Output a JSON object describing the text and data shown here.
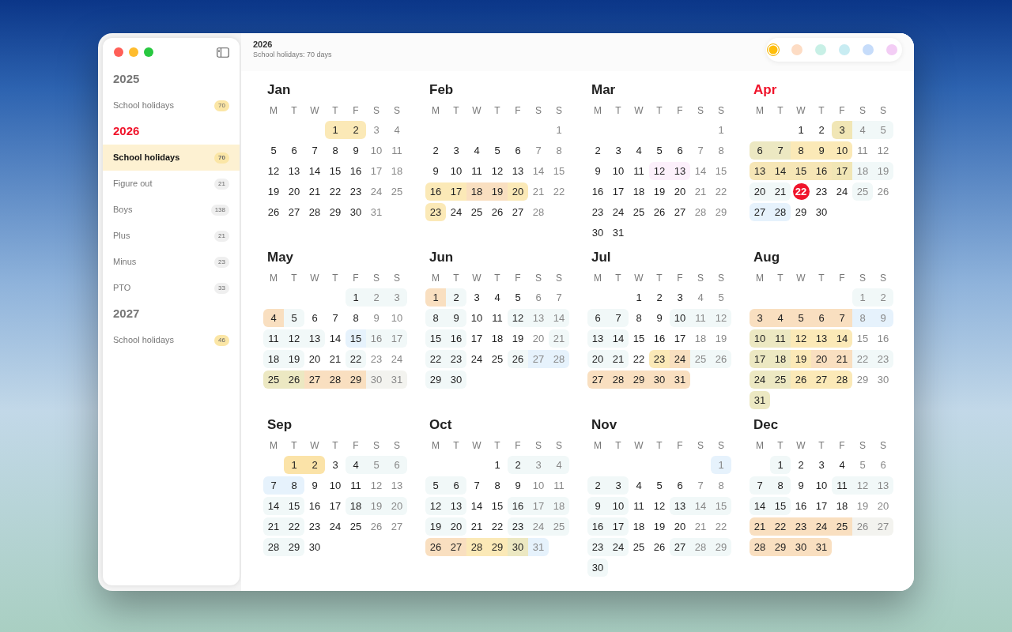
{
  "sidebar": {
    "years": [
      {
        "year": "2025",
        "current": false,
        "items": [
          {
            "label": "School holidays",
            "count": "70",
            "color": "#fbe6a6",
            "selected": false
          }
        ]
      },
      {
        "year": "2026",
        "current": true,
        "items": [
          {
            "label": "School holidays",
            "count": "70",
            "color": "#fbe6a6",
            "selected": true
          },
          {
            "label": "Figure out",
            "count": "21",
            "color": "#efefef",
            "selected": false
          },
          {
            "label": "Boys",
            "count": "138",
            "color": "#efefef",
            "selected": false
          },
          {
            "label": "Plus",
            "count": "21",
            "color": "#efefef",
            "selected": false
          },
          {
            "label": "Minus",
            "count": "23",
            "color": "#efefef",
            "selected": false
          },
          {
            "label": "PTO",
            "count": "33",
            "color": "#efefef",
            "selected": false
          }
        ]
      },
      {
        "year": "2027",
        "current": false,
        "items": [
          {
            "label": "School holidays",
            "count": "46",
            "color": "#fbe6a6",
            "selected": false
          }
        ]
      }
    ]
  },
  "header": {
    "title": "2026",
    "subtitle": "School holidays: 70 days"
  },
  "palette": [
    {
      "color": "#ffbe0b",
      "selected": true
    },
    {
      "color": "#fddcc4",
      "selected": false
    },
    {
      "color": "#c8f0e6",
      "selected": false
    },
    {
      "color": "#c8ecf2",
      "selected": false
    },
    {
      "color": "#c6dcfa",
      "selected": false
    },
    {
      "color": "#f3cdf5",
      "selected": false
    }
  ],
  "months": [
    {
      "name": "Jan",
      "current": false,
      "weekdays": [
        "M",
        "T",
        "W",
        "T",
        "F",
        "S",
        "S"
      ],
      "weeks": [
        [
          {
            "day": "1",
            "color": "#fbe9b7"
          },
          {
            "day": "2",
            "color": "#fbe9b7"
          },
          {
            "day": "3"
          },
          {
            "day": "4"
          }
        ],
        [
          {
            "day": "5"
          },
          {
            "day": "6"
          },
          {
            "day": "7"
          },
          {
            "day": "8"
          },
          {
            "day": "9"
          },
          {
            "day": "10"
          },
          {
            "day": "11"
          }
        ],
        [
          {
            "day": "12"
          },
          {
            "day": "13"
          },
          {
            "day": "14"
          },
          {
            "day": "15"
          },
          {
            "day": "16"
          },
          {
            "day": "17"
          },
          {
            "day": "18"
          }
        ],
        [
          {
            "day": "19"
          },
          {
            "day": "20"
          },
          {
            "day": "21"
          },
          {
            "day": "22"
          },
          {
            "day": "23"
          },
          {
            "day": "24"
          },
          {
            "day": "25"
          }
        ],
        [
          {
            "day": "26"
          },
          {
            "day": "27"
          },
          {
            "day": "28"
          },
          {
            "day": "29"
          },
          {
            "day": "30"
          },
          {
            "day": "31"
          }
        ]
      ]
    },
    {
      "name": "Feb",
      "current": false,
      "weekdays": [
        "M",
        "T",
        "W",
        "T",
        "F",
        "S",
        "S"
      ],
      "weeks": [
        [
          {
            "day": "1"
          }
        ],
        [
          {
            "day": "2"
          },
          {
            "day": "3"
          },
          {
            "day": "4"
          },
          {
            "day": "5"
          },
          {
            "day": "6"
          },
          {
            "day": "7"
          },
          {
            "day": "8"
          }
        ],
        [
          {
            "day": "9"
          },
          {
            "day": "10"
          },
          {
            "day": "11"
          },
          {
            "day": "12"
          },
          {
            "day": "13"
          },
          {
            "day": "14"
          },
          {
            "day": "15"
          }
        ],
        [
          {
            "day": "16",
            "color": "#fbe9b7"
          },
          {
            "day": "17",
            "color": "#fbe9b7"
          },
          {
            "day": "18",
            "color": "#f9dfc0"
          },
          {
            "day": "19",
            "color": "#f9dfc0"
          },
          {
            "day": "20",
            "color": "#fbe9b7"
          },
          {
            "day": "21"
          },
          {
            "day": "22"
          }
        ],
        [
          {
            "day": "23",
            "color": "#fbe9b7"
          },
          {
            "day": "24"
          },
          {
            "day": "25"
          },
          {
            "day": "26"
          },
          {
            "day": "27"
          },
          {
            "day": "28"
          }
        ]
      ]
    },
    {
      "name": "Mar",
      "current": false,
      "weekdays": [
        "M",
        "T",
        "W",
        "T",
        "F",
        "S",
        "S"
      ],
      "weeks": [
        [
          {
            "day": "1"
          }
        ],
        [
          {
            "day": "2"
          },
          {
            "day": "3"
          },
          {
            "day": "4"
          },
          {
            "day": "5"
          },
          {
            "day": "6"
          },
          {
            "day": "7"
          },
          {
            "day": "8"
          }
        ],
        [
          {
            "day": "9"
          },
          {
            "day": "10"
          },
          {
            "day": "11"
          },
          {
            "day": "12",
            "color": "#fcf0fb"
          },
          {
            "day": "13",
            "color": "#fcf0fb"
          },
          {
            "day": "14"
          },
          {
            "day": "15"
          }
        ],
        [
          {
            "day": "16"
          },
          {
            "day": "17"
          },
          {
            "day": "18"
          },
          {
            "day": "19"
          },
          {
            "day": "20"
          },
          {
            "day": "21"
          },
          {
            "day": "22"
          }
        ],
        [
          {
            "day": "23"
          },
          {
            "day": "24"
          },
          {
            "day": "25"
          },
          {
            "day": "26"
          },
          {
            "day": "27"
          },
          {
            "day": "28"
          },
          {
            "day": "29"
          }
        ],
        [
          {
            "day": "30"
          },
          {
            "day": "31"
          }
        ]
      ]
    },
    {
      "name": "Apr",
      "current": true,
      "weekdays": [
        "M",
        "T",
        "W",
        "T",
        "F",
        "S",
        "S"
      ],
      "weeks": [
        [
          {
            "day": "1"
          },
          {
            "day": "2"
          },
          {
            "day": "3",
            "color": "#f1e6b5"
          },
          {
            "day": "4",
            "color": "#f1f8f8"
          },
          {
            "day": "5",
            "color": "#f1f8f8"
          }
        ],
        [
          {
            "day": "6",
            "color": "#ece8c2"
          },
          {
            "day": "7",
            "color": "#ece8c2"
          },
          {
            "day": "8",
            "color": "#fbe9b7"
          },
          {
            "day": "9",
            "color": "#fbe9b7"
          },
          {
            "day": "10",
            "color": "#fbe9b7"
          },
          {
            "day": "11"
          },
          {
            "day": "12"
          }
        ],
        [
          {
            "day": "13",
            "color": "#f6e6b6"
          },
          {
            "day": "14",
            "color": "#f6e6b6"
          },
          {
            "day": "15",
            "color": "#f6e6b6"
          },
          {
            "day": "16",
            "color": "#f6e6b6"
          },
          {
            "day": "17",
            "color": "#f1e6b5"
          },
          {
            "day": "18",
            "color": "#f1f8f8"
          },
          {
            "day": "19",
            "color": "#f1f8f8"
          }
        ],
        [
          {
            "day": "20",
            "color": "#f1f8f8"
          },
          {
            "day": "21",
            "color": "#f1f8f8"
          },
          {
            "day": "22",
            "today": true
          },
          {
            "day": "23"
          },
          {
            "day": "24"
          },
          {
            "day": "25",
            "color": "#f1f8f8"
          },
          {
            "day": "26"
          }
        ],
        [
          {
            "day": "27",
            "color": "#e6f2fc"
          },
          {
            "day": "28",
            "color": "#e6f2fc"
          },
          {
            "day": "29"
          },
          {
            "day": "30"
          }
        ]
      ]
    },
    {
      "name": "May",
      "current": false,
      "weekdays": [
        "M",
        "T",
        "W",
        "T",
        "F",
        "S",
        "S"
      ],
      "weeks": [
        [
          {
            "day": "1",
            "color": "#f1f8f8"
          },
          {
            "day": "2",
            "color": "#f1f8f8"
          },
          {
            "day": "3",
            "color": "#f1f8f8"
          }
        ],
        [
          {
            "day": "4",
            "color": "#f9dfc0"
          },
          {
            "day": "5",
            "color": "#f1f8f8"
          },
          {
            "day": "6"
          },
          {
            "day": "7"
          },
          {
            "day": "8"
          },
          {
            "day": "9"
          },
          {
            "day": "10"
          }
        ],
        [
          {
            "day": "11",
            "color": "#f1f8f8"
          },
          {
            "day": "12",
            "color": "#f1f8f8"
          },
          {
            "day": "13",
            "color": "#f1f8f8"
          },
          {
            "day": "14"
          },
          {
            "day": "15",
            "color": "#e6f2fc"
          },
          {
            "day": "16",
            "color": "#f1f8f8"
          },
          {
            "day": "17",
            "color": "#f1f8f8"
          }
        ],
        [
          {
            "day": "18",
            "color": "#f1f8f8"
          },
          {
            "day": "19",
            "color": "#f1f8f8"
          },
          {
            "day": "20"
          },
          {
            "day": "21"
          },
          {
            "day": "22",
            "color": "#f1f8f8"
          },
          {
            "day": "23"
          },
          {
            "day": "24"
          }
        ],
        [
          {
            "day": "25",
            "color": "#ece8c2"
          },
          {
            "day": "26",
            "color": "#ece8c2"
          },
          {
            "day": "27",
            "color": "#f9dfc0"
          },
          {
            "day": "28",
            "color": "#f9dfc0"
          },
          {
            "day": "29",
            "color": "#f9dfc0"
          },
          {
            "day": "30",
            "color": "#f3f3ef"
          },
          {
            "day": "31",
            "color": "#f3f3ef"
          }
        ]
      ]
    },
    {
      "name": "Jun",
      "current": false,
      "weekdays": [
        "M",
        "T",
        "W",
        "T",
        "F",
        "S",
        "S"
      ],
      "weeks": [
        [
          {
            "day": "1",
            "color": "#f9dfc0"
          },
          {
            "day": "2",
            "color": "#f1f8f8"
          },
          {
            "day": "3"
          },
          {
            "day": "4"
          },
          {
            "day": "5"
          },
          {
            "day": "6"
          },
          {
            "day": "7"
          }
        ],
        [
          {
            "day": "8",
            "color": "#f1f8f8"
          },
          {
            "day": "9",
            "color": "#f1f8f8"
          },
          {
            "day": "10"
          },
          {
            "day": "11"
          },
          {
            "day": "12",
            "color": "#f1f8f8"
          },
          {
            "day": "13",
            "color": "#f1f8f8"
          },
          {
            "day": "14",
            "color": "#f1f8f8"
          }
        ],
        [
          {
            "day": "15",
            "color": "#f1f8f8"
          },
          {
            "day": "16",
            "color": "#f1f8f8"
          },
          {
            "day": "17"
          },
          {
            "day": "18"
          },
          {
            "day": "19"
          },
          {
            "day": "20"
          },
          {
            "day": "21",
            "color": "#f1f8f8"
          }
        ],
        [
          {
            "day": "22",
            "color": "#f1f8f8"
          },
          {
            "day": "23",
            "color": "#f1f8f8"
          },
          {
            "day": "24"
          },
          {
            "day": "25"
          },
          {
            "day": "26",
            "color": "#f1f8f8"
          },
          {
            "day": "27",
            "color": "#e6f2fc"
          },
          {
            "day": "28",
            "color": "#e6f2fc"
          }
        ],
        [
          {
            "day": "29",
            "color": "#f1f8f8"
          },
          {
            "day": "30",
            "color": "#f1f8f8"
          }
        ]
      ]
    },
    {
      "name": "Jul",
      "current": false,
      "weekdays": [
        "M",
        "T",
        "W",
        "T",
        "F",
        "S",
        "S"
      ],
      "weeks": [
        [
          {
            "day": "1"
          },
          {
            "day": "2"
          },
          {
            "day": "3"
          },
          {
            "day": "4"
          },
          {
            "day": "5"
          }
        ],
        [
          {
            "day": "6",
            "color": "#f1f8f8"
          },
          {
            "day": "7",
            "color": "#f1f8f8"
          },
          {
            "day": "8"
          },
          {
            "day": "9"
          },
          {
            "day": "10",
            "color": "#f1f8f8"
          },
          {
            "day": "11",
            "color": "#f1f8f8"
          },
          {
            "day": "12",
            "color": "#f1f8f8"
          }
        ],
        [
          {
            "day": "13",
            "color": "#f1f8f8"
          },
          {
            "day": "14",
            "color": "#f1f8f8"
          },
          {
            "day": "15"
          },
          {
            "day": "16"
          },
          {
            "day": "17"
          },
          {
            "day": "18"
          },
          {
            "day": "19"
          }
        ],
        [
          {
            "day": "20",
            "color": "#f1f8f8"
          },
          {
            "day": "21",
            "color": "#f1f8f8"
          },
          {
            "day": "22"
          },
          {
            "day": "23",
            "color": "#fbe9b7"
          },
          {
            "day": "24",
            "color": "#f9dfc0"
          },
          {
            "day": "25",
            "color": "#f1f8f8"
          },
          {
            "day": "26",
            "color": "#f1f8f8"
          }
        ],
        [
          {
            "day": "27",
            "color": "#f9dfc0"
          },
          {
            "day": "28",
            "color": "#f9dfc0"
          },
          {
            "day": "29",
            "color": "#f9dfc0"
          },
          {
            "day": "30",
            "color": "#f9dfc0"
          },
          {
            "day": "31",
            "color": "#f9dfc0"
          }
        ]
      ]
    },
    {
      "name": "Aug",
      "current": false,
      "weekdays": [
        "M",
        "T",
        "W",
        "T",
        "F",
        "S",
        "S"
      ],
      "weeks": [
        [
          {
            "day": "1",
            "color": "#f1f8f8"
          },
          {
            "day": "2",
            "color": "#f1f8f8"
          }
        ],
        [
          {
            "day": "3",
            "color": "#f9dfc0"
          },
          {
            "day": "4",
            "color": "#f9dfc0"
          },
          {
            "day": "5",
            "color": "#f9dfc0"
          },
          {
            "day": "6",
            "color": "#f9dfc0"
          },
          {
            "day": "7",
            "color": "#f9dfc0"
          },
          {
            "day": "8",
            "color": "#e6f2fc"
          },
          {
            "day": "9",
            "color": "#e6f2fc"
          }
        ],
        [
          {
            "day": "10",
            "color": "#ece8c2"
          },
          {
            "day": "11",
            "color": "#ece8c2"
          },
          {
            "day": "12",
            "color": "#fbe9b7"
          },
          {
            "day": "13",
            "color": "#fbe9b7"
          },
          {
            "day": "14",
            "color": "#fbe9b7"
          },
          {
            "day": "15"
          },
          {
            "day": "16"
          }
        ],
        [
          {
            "day": "17",
            "color": "#ece8c2"
          },
          {
            "day": "18",
            "color": "#ece8c2"
          },
          {
            "day": "19",
            "color": "#fbe9b7"
          },
          {
            "day": "20",
            "color": "#f9dfc0"
          },
          {
            "day": "21",
            "color": "#f9dfc0"
          },
          {
            "day": "22",
            "color": "#f1f8f8"
          },
          {
            "day": "23",
            "color": "#f1f8f8"
          }
        ],
        [
          {
            "day": "24",
            "color": "#ece8c2"
          },
          {
            "day": "25",
            "color": "#ece8c2"
          },
          {
            "day": "26",
            "color": "#fbe9b7"
          },
          {
            "day": "27",
            "color": "#fbe9b7"
          },
          {
            "day": "28",
            "color": "#fbe9b7"
          },
          {
            "day": "29"
          },
          {
            "day": "30"
          }
        ],
        [
          {
            "day": "31",
            "color": "#ece8c2"
          }
        ]
      ]
    },
    {
      "name": "Sep",
      "current": false,
      "weekdays": [
        "M",
        "T",
        "W",
        "T",
        "F",
        "S",
        "S"
      ],
      "weeks": [
        [
          {
            "day": "1",
            "color": "#fbe3a8"
          },
          {
            "day": "2",
            "color": "#fbe3a8"
          },
          {
            "day": "3"
          },
          {
            "day": "4",
            "color": "#f1f8f8"
          },
          {
            "day": "5",
            "color": "#f1f8f8"
          },
          {
            "day": "6",
            "color": "#f1f8f8"
          }
        ],
        [
          {
            "day": "7",
            "color": "#e6f2fc"
          },
          {
            "day": "8",
            "color": "#e6f2fc"
          },
          {
            "day": "9"
          },
          {
            "day": "10"
          },
          {
            "day": "11"
          },
          {
            "day": "12"
          },
          {
            "day": "13"
          }
        ],
        [
          {
            "day": "14",
            "color": "#f1f8f8"
          },
          {
            "day": "15",
            "color": "#f1f8f8"
          },
          {
            "day": "16"
          },
          {
            "day": "17"
          },
          {
            "day": "18",
            "color": "#f1f8f8"
          },
          {
            "day": "19",
            "color": "#f1f8f8"
          },
          {
            "day": "20",
            "color": "#f1f8f8"
          }
        ],
        [
          {
            "day": "21",
            "color": "#f1f8f8"
          },
          {
            "day": "22",
            "color": "#f1f8f8"
          },
          {
            "day": "23"
          },
          {
            "day": "24"
          },
          {
            "day": "25"
          },
          {
            "day": "26"
          },
          {
            "day": "27"
          }
        ],
        [
          {
            "day": "28",
            "color": "#f1f8f8"
          },
          {
            "day": "29",
            "color": "#f1f8f8"
          },
          {
            "day": "30"
          }
        ]
      ]
    },
    {
      "name": "Oct",
      "current": false,
      "weekdays": [
        "M",
        "T",
        "W",
        "T",
        "F",
        "S",
        "S"
      ],
      "weeks": [
        [
          {
            "day": "1"
          },
          {
            "day": "2",
            "color": "#f1f8f8"
          },
          {
            "day": "3",
            "color": "#f1f8f8"
          },
          {
            "day": "4",
            "color": "#f1f8f8"
          }
        ],
        [
          {
            "day": "5",
            "color": "#f1f8f8"
          },
          {
            "day": "6",
            "color": "#f1f8f8"
          },
          {
            "day": "7"
          },
          {
            "day": "8"
          },
          {
            "day": "9"
          },
          {
            "day": "10"
          },
          {
            "day": "11"
          }
        ],
        [
          {
            "day": "12",
            "color": "#f1f8f8"
          },
          {
            "day": "13",
            "color": "#f1f8f8"
          },
          {
            "day": "14"
          },
          {
            "day": "15"
          },
          {
            "day": "16",
            "color": "#f1f8f8"
          },
          {
            "day": "17",
            "color": "#f1f8f8"
          },
          {
            "day": "18",
            "color": "#f1f8f8"
          }
        ],
        [
          {
            "day": "19",
            "color": "#f1f8f8"
          },
          {
            "day": "20",
            "color": "#f1f8f8"
          },
          {
            "day": "21"
          },
          {
            "day": "22"
          },
          {
            "day": "23",
            "color": "#f1f8f8"
          },
          {
            "day": "24",
            "color": "#f1f8f8"
          },
          {
            "day": "25",
            "color": "#f1f8f8"
          }
        ],
        [
          {
            "day": "26",
            "color": "#f9dfc0"
          },
          {
            "day": "27",
            "color": "#f9dfc0"
          },
          {
            "day": "28",
            "color": "#fbe9b7"
          },
          {
            "day": "29",
            "color": "#fbe9b7"
          },
          {
            "day": "30",
            "color": "#ece8c2"
          },
          {
            "day": "31",
            "color": "#e6f2fc"
          }
        ]
      ]
    },
    {
      "name": "Nov",
      "current": false,
      "weekdays": [
        "M",
        "T",
        "W",
        "T",
        "F",
        "S",
        "S"
      ],
      "weeks": [
        [
          {
            "day": "1",
            "color": "#e6f2fc"
          }
        ],
        [
          {
            "day": "2",
            "color": "#f1f8f8"
          },
          {
            "day": "3",
            "color": "#f1f8f8"
          },
          {
            "day": "4"
          },
          {
            "day": "5"
          },
          {
            "day": "6"
          },
          {
            "day": "7"
          },
          {
            "day": "8"
          }
        ],
        [
          {
            "day": "9",
            "color": "#f1f8f8"
          },
          {
            "day": "10",
            "color": "#f1f8f8"
          },
          {
            "day": "11"
          },
          {
            "day": "12"
          },
          {
            "day": "13",
            "color": "#f1f8f8"
          },
          {
            "day": "14",
            "color": "#f1f8f8"
          },
          {
            "day": "15",
            "color": "#f1f8f8"
          }
        ],
        [
          {
            "day": "16",
            "color": "#f1f8f8"
          },
          {
            "day": "17",
            "color": "#f1f8f8"
          },
          {
            "day": "18"
          },
          {
            "day": "19"
          },
          {
            "day": "20"
          },
          {
            "day": "21"
          },
          {
            "day": "22"
          }
        ],
        [
          {
            "day": "23",
            "color": "#f1f8f8"
          },
          {
            "day": "24",
            "color": "#f1f8f8"
          },
          {
            "day": "25"
          },
          {
            "day": "26"
          },
          {
            "day": "27",
            "color": "#f1f8f8"
          },
          {
            "day": "28",
            "color": "#f1f8f8"
          },
          {
            "day": "29",
            "color": "#f1f8f8"
          }
        ],
        [
          {
            "day": "30",
            "color": "#f1f8f8"
          }
        ]
      ]
    },
    {
      "name": "Dec",
      "current": false,
      "weekdays": [
        "M",
        "T",
        "W",
        "T",
        "F",
        "S",
        "S"
      ],
      "weeks": [
        [
          {
            "day": "1",
            "color": "#f1f8f8"
          },
          {
            "day": "2"
          },
          {
            "day": "3"
          },
          {
            "day": "4"
          },
          {
            "day": "5"
          },
          {
            "day": "6"
          }
        ],
        [
          {
            "day": "7",
            "color": "#f1f8f8"
          },
          {
            "day": "8",
            "color": "#f1f8f8"
          },
          {
            "day": "9"
          },
          {
            "day": "10"
          },
          {
            "day": "11",
            "color": "#f1f8f8"
          },
          {
            "day": "12",
            "color": "#f1f8f8"
          },
          {
            "day": "13",
            "color": "#f1f8f8"
          }
        ],
        [
          {
            "day": "14",
            "color": "#f1f8f8"
          },
          {
            "day": "15",
            "color": "#f1f8f8"
          },
          {
            "day": "16"
          },
          {
            "day": "17"
          },
          {
            "day": "18"
          },
          {
            "day": "19"
          },
          {
            "day": "20"
          }
        ],
        [
          {
            "day": "21",
            "color": "#f9dfc0"
          },
          {
            "day": "22",
            "color": "#f9dfc0"
          },
          {
            "day": "23",
            "color": "#f9dfc0"
          },
          {
            "day": "24",
            "color": "#f9dfc0"
          },
          {
            "day": "25",
            "color": "#f9dfc0"
          },
          {
            "day": "26",
            "color": "#f3f3ef"
          },
          {
            "day": "27",
            "color": "#f3f3ef"
          }
        ],
        [
          {
            "day": "28",
            "color": "#f9dfc0"
          },
          {
            "day": "29",
            "color": "#f9dfc0"
          },
          {
            "day": "30",
            "color": "#f9dfc0"
          },
          {
            "day": "31",
            "color": "#f9dfc0"
          }
        ]
      ]
    }
  ]
}
